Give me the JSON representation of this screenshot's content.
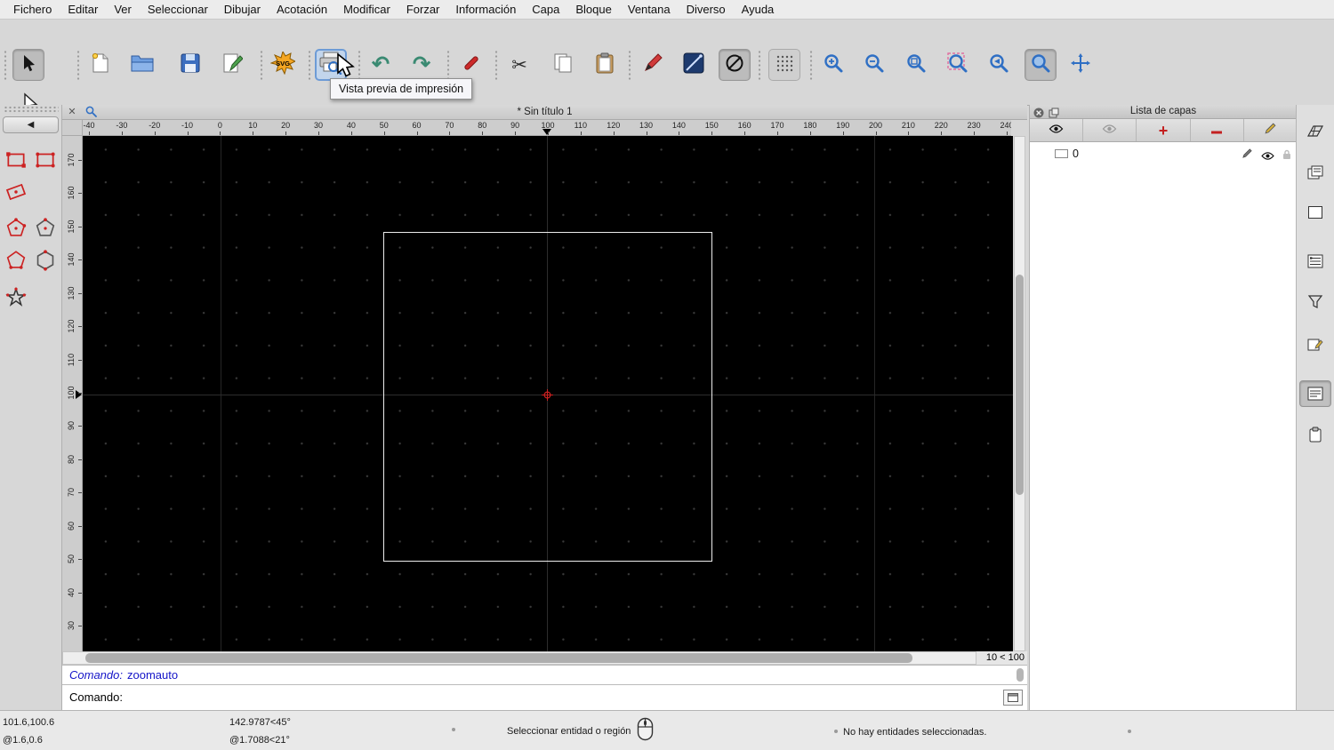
{
  "window": {
    "title_tab": "* Sin título 1"
  },
  "menu": {
    "items": [
      "Fichero",
      "Editar",
      "Ver",
      "Seleccionar",
      "Dibujar",
      "Acotación",
      "Modificar",
      "Forzar",
      "Información",
      "Capa",
      "Bloque",
      "Ventana",
      "Diverso",
      "Ayuda"
    ]
  },
  "toolbar": {
    "svg_badge": "SVG"
  },
  "tooltip": {
    "text": "Vista previa de impresión"
  },
  "icons": {
    "undo": "↶",
    "redo": "↷",
    "cut": "✂",
    "collapse": "◀",
    "tab_close": "✕",
    "plus": "+"
  },
  "rulers": {
    "horizontal": [
      "-40",
      "-30",
      "-20",
      "-10",
      "0",
      "10",
      "20",
      "30",
      "40",
      "50",
      "60",
      "70",
      "80",
      "90",
      "100",
      "110",
      "120",
      "130",
      "140",
      "150",
      "160",
      "170",
      "180",
      "190",
      "200",
      "210",
      "220",
      "230",
      "240"
    ],
    "vertical": [
      "170",
      "160",
      "150",
      "140",
      "130",
      "120",
      "110",
      "100",
      "90",
      "80",
      "70",
      "60",
      "50",
      "40",
      "30"
    ]
  },
  "canvas": {
    "grid_indicator": "10 < 100"
  },
  "command": {
    "history_label": "Comando:",
    "history_value": "zoomauto",
    "prompt_label": "Comando:",
    "prompt_value": ""
  },
  "layer_panel": {
    "title": "Lista de capas",
    "layers": [
      {
        "name": "0"
      }
    ]
  },
  "status_bar": {
    "coord_abs": "101.6,100.6",
    "coord_rel": "@1.6,0.6",
    "polar_abs": "142.9787<45°",
    "polar_rel": "@1.7088<21°",
    "hint": "Seleccionar entidad o región",
    "selection_info": "No hay entidades seleccionadas."
  },
  "colors": {
    "canvas_bg": "#000000",
    "accent_blue": "#2f6fc4",
    "marker_red": "#cc2222",
    "command_blue": "#1414c8",
    "entity_white": "#ededed"
  }
}
